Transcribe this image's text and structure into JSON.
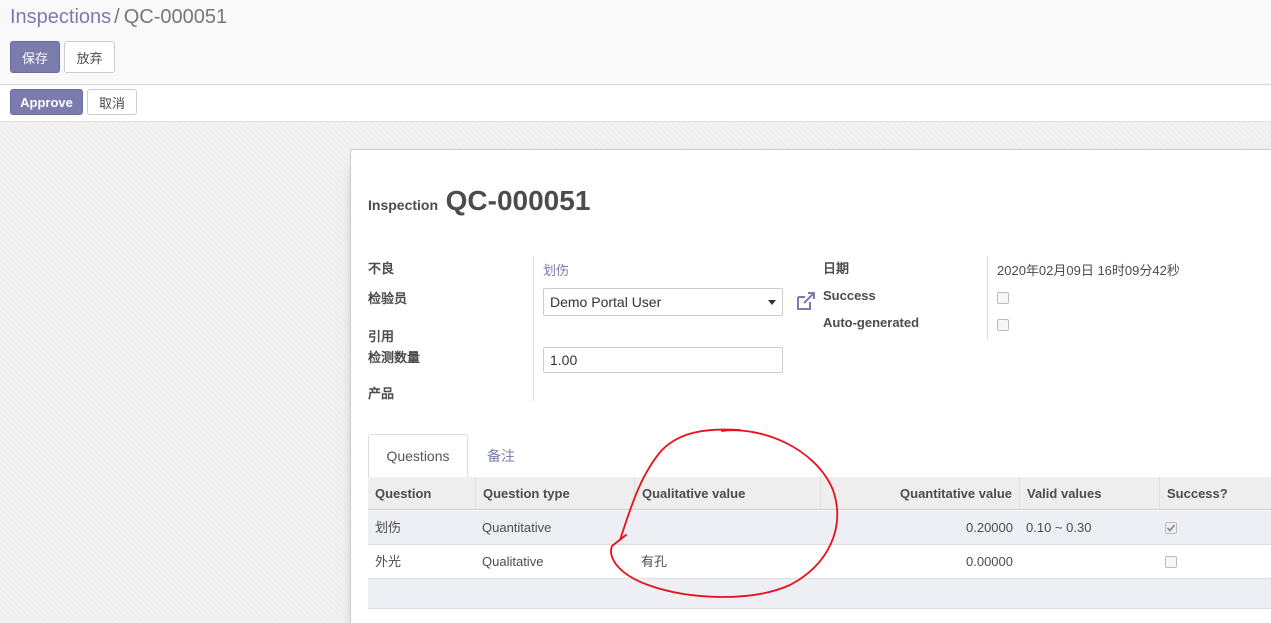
{
  "breadcrumb": {
    "parent": "Inspections",
    "separator": "/",
    "current": "QC-000051"
  },
  "actions": {
    "save_label": "保存",
    "discard_label": "放弃"
  },
  "statusbar": {
    "approve_label": "Approve",
    "cancel_label": "取消"
  },
  "form": {
    "title_label": "Inspection",
    "title_name": "QC-000051",
    "left_fields": {
      "defect_label": "不良",
      "defect_value": "划伤",
      "inspector_label": "检验员",
      "inspector_value": "Demo Portal User",
      "reference_label": "引用",
      "qty_label": "检测数量",
      "qty_value": "1.00",
      "product_label": "产品"
    },
    "right_fields": {
      "date_label": "日期",
      "date_value": "2020年02月09日 16时09分42秒",
      "success_label": "Success",
      "success_checked": false,
      "auto_label": "Auto-generated",
      "auto_checked": false
    }
  },
  "tabs": [
    {
      "label": "Questions",
      "active": true
    },
    {
      "label": "备注",
      "active": false
    }
  ],
  "table": {
    "headers": [
      "Question",
      "Question type",
      "Qualitative value",
      "Quantitative value",
      "Valid values",
      "Success?"
    ],
    "rows": [
      {
        "question": "划伤",
        "type": "Quantitative",
        "qualitative": "",
        "quantitative": "0.20000",
        "valid": "0.10 ~ 0.30",
        "success": true
      },
      {
        "question": "外光",
        "type": "Qualitative",
        "qualitative": "有孔",
        "quantitative": "0.00000",
        "valid": "",
        "success": false
      }
    ]
  },
  "colors": {
    "brand": "#7c7bad",
    "annotation": "#e8111b",
    "row_highlight": "#eeeef5"
  },
  "icons": [
    "external-link-icon",
    "dropdown-caret-icon",
    "checkbox-icon"
  ]
}
